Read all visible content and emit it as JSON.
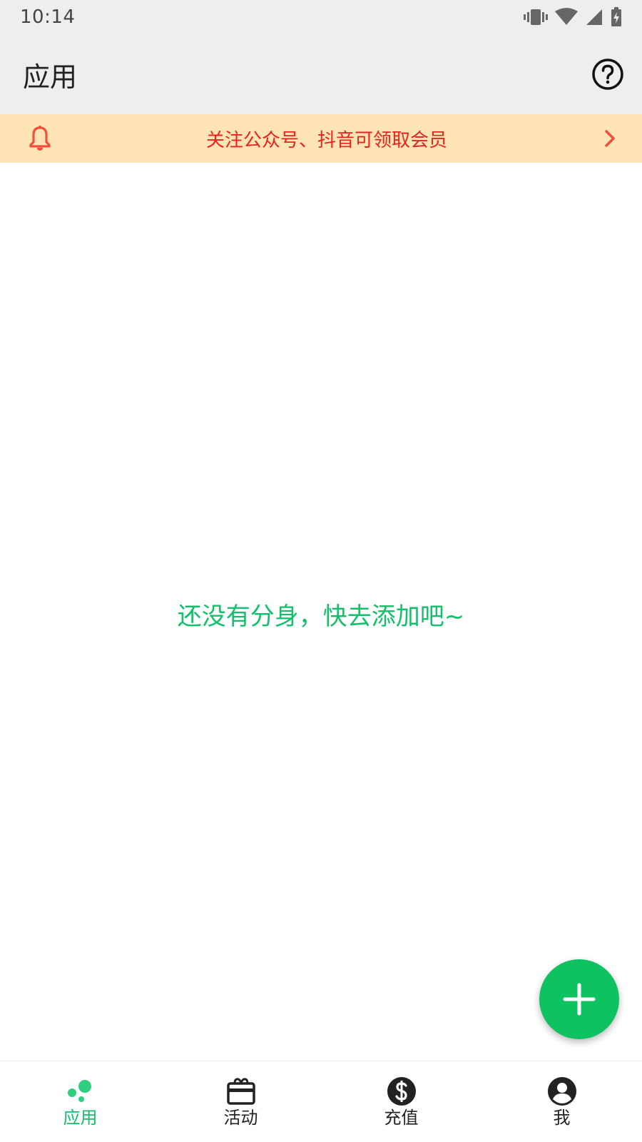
{
  "status_bar": {
    "time": "10:14",
    "icons": [
      "vibrate-icon",
      "wifi-icon",
      "signal-icon",
      "battery-icon"
    ]
  },
  "app_bar": {
    "title": "应用",
    "help_icon": "help-circle-icon"
  },
  "notice": {
    "text": "关注公众号、抖音可领取会员",
    "icon": "bell-icon",
    "arrow_icon": "chevron-right-icon",
    "text_color": "#e8231e",
    "background": "#ffe4b5"
  },
  "main": {
    "empty_message": "还没有分身，快去添加吧~"
  },
  "fab": {
    "icon": "plus-icon",
    "color": "#0ec262"
  },
  "bottom_nav": {
    "items": [
      {
        "label": "应用",
        "icon": "apps-dots-icon",
        "active": true
      },
      {
        "label": "活动",
        "icon": "gift-box-icon",
        "active": false
      },
      {
        "label": "充值",
        "icon": "dollar-circle-icon",
        "active": false
      },
      {
        "label": "我",
        "icon": "account-circle-icon",
        "active": false
      }
    ]
  },
  "colors": {
    "accent": "#12c06a",
    "bar_background": "#eeeeee"
  }
}
